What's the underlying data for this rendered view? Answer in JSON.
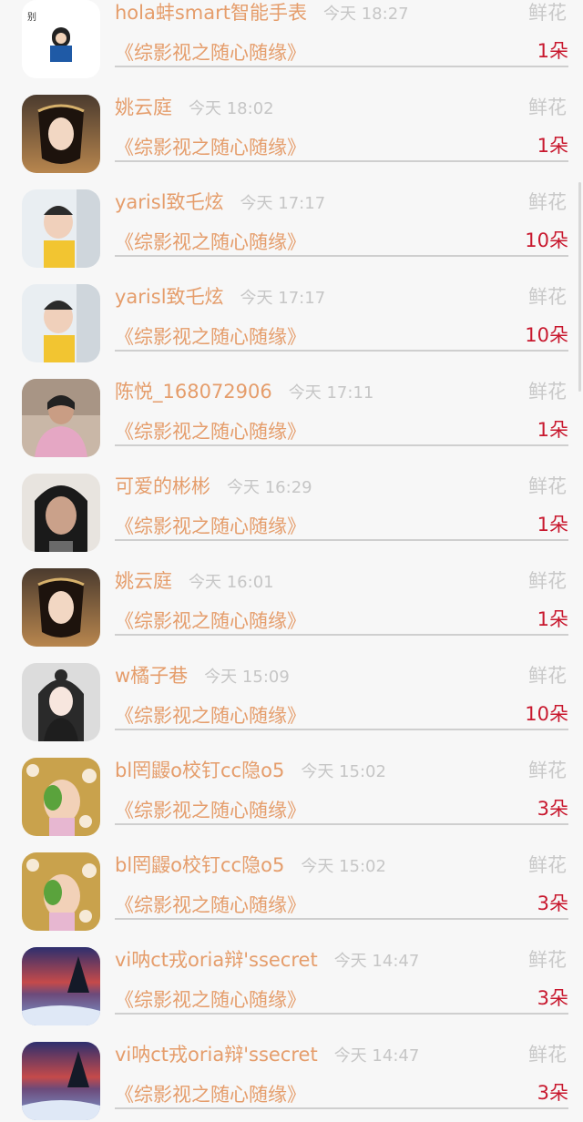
{
  "gift_list": [
    {
      "user": "hola蚌smart智能手表",
      "time": "今天 18:27",
      "gift_type": "鲜花",
      "book": "《综影视之随心随缘》",
      "amount": "1朵",
      "avatar": "cartoon-boy-avatar"
    },
    {
      "user": "姚云庭",
      "time": "今天 18:02",
      "gift_type": "鲜花",
      "book": "《综影视之随心随缘》",
      "amount": "1朵",
      "avatar": "costume-woman-avatar"
    },
    {
      "user": "yarisl致乇炫",
      "time": "今天 17:17",
      "gift_type": "鲜花",
      "book": "《综影视之随心随缘》",
      "amount": "10朵",
      "avatar": "child-photo-avatar"
    },
    {
      "user": "yarisl致乇炫",
      "time": "今天 17:17",
      "gift_type": "鲜花",
      "book": "《综影视之随心随缘》",
      "amount": "10朵",
      "avatar": "child-photo-avatar"
    },
    {
      "user": "陈悦_168072906",
      "time": "今天 17:11",
      "gift_type": "鲜花",
      "book": "《综影视之随心随缘》",
      "amount": "1朵",
      "avatar": "woman-pink-coat-avatar"
    },
    {
      "user": "可爱的彬彬",
      "time": "今天 16:29",
      "gift_type": "鲜花",
      "book": "《综影视之随心随缘》",
      "amount": "1朵",
      "avatar": "woman-selfie-avatar"
    },
    {
      "user": "姚云庭",
      "time": "今天 16:01",
      "gift_type": "鲜花",
      "book": "《综影视之随心随缘》",
      "amount": "1朵",
      "avatar": "costume-woman-avatar"
    },
    {
      "user": "w橘子巷",
      "time": "今天 15:09",
      "gift_type": "鲜花",
      "book": "《综影视之随心随缘》",
      "amount": "10朵",
      "avatar": "anime-girl-avatar"
    },
    {
      "user": "bl罔鼹o校钉cc隐o5",
      "time": "今天 15:02",
      "gift_type": "鲜花",
      "book": "《综影视之随心随缘》",
      "amount": "3朵",
      "avatar": "cartoon-cat-avatar"
    },
    {
      "user": "bl罔鼹o校钉cc隐o5",
      "time": "今天 15:02",
      "gift_type": "鲜花",
      "book": "《综影视之随心随缘》",
      "amount": "3朵",
      "avatar": "cartoon-cat-avatar"
    },
    {
      "user": "vi呐ct戎oria辩'ssecret",
      "time": "今天 14:47",
      "gift_type": "鲜花",
      "book": "《综影视之随心随缘》",
      "amount": "3朵",
      "avatar": "snowy-sunset-avatar"
    },
    {
      "user": "vi呐ct戎oria辩'ssecret",
      "time": "今天 14:47",
      "gift_type": "鲜花",
      "book": "《综影视之随心随缘》",
      "amount": "3朵",
      "avatar": "snowy-sunset-avatar"
    }
  ],
  "colors": {
    "name": "#e59d6b",
    "time": "#c6c6c6",
    "gift_type": "#c9c9c9",
    "amount": "#c8182e",
    "background": "#f7f7f7"
  }
}
